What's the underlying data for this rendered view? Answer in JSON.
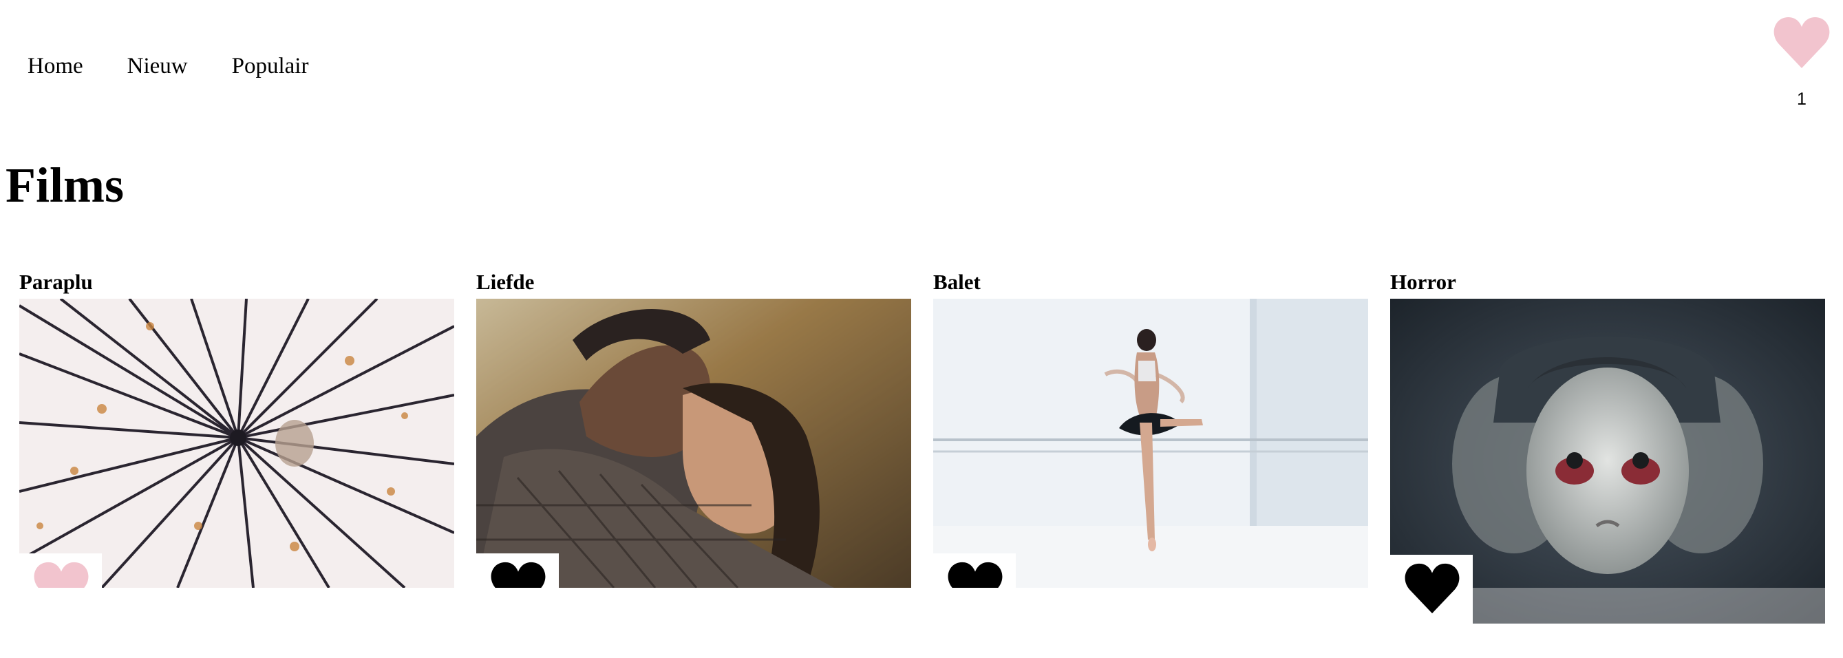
{
  "nav": {
    "items": [
      "Home",
      "Nieuw",
      "Populair"
    ]
  },
  "favorites": {
    "count": "1",
    "icon": "heart-icon",
    "color": "#f2c4ce"
  },
  "page": {
    "title": "Films"
  },
  "films": [
    {
      "title": "Paraplu",
      "favorite": true
    },
    {
      "title": "Liefde",
      "favorite": false
    },
    {
      "title": "Balet",
      "favorite": false
    },
    {
      "title": "Horror",
      "favorite": false
    }
  ],
  "colors": {
    "heart_active": "#f2c4ce",
    "heart_inactive": "#000000"
  }
}
